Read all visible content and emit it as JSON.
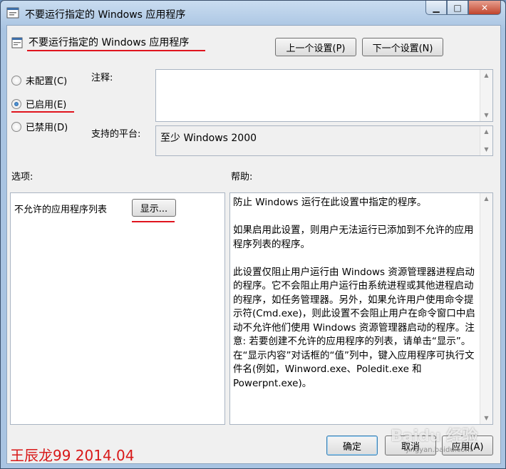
{
  "window": {
    "title": "不要运行指定的 Windows 应用程序",
    "caption_min": "▁",
    "caption_max": "□",
    "caption_close": "✕"
  },
  "header": {
    "setting_name": "不要运行指定的 Windows 应用程序",
    "prev_button": "上一个设置(P)",
    "next_button": "下一个设置(N)"
  },
  "state": {
    "options": [
      {
        "label": "未配置(C)",
        "checked": false
      },
      {
        "label": "已启用(E)",
        "checked": true
      },
      {
        "label": "已禁用(D)",
        "checked": false
      }
    ]
  },
  "comment": {
    "label": "注释:",
    "value": ""
  },
  "platform": {
    "label": "支持的平台:",
    "value": "至少 Windows 2000"
  },
  "options_section": {
    "label": "选项:",
    "item_label": "不允许的应用程序列表",
    "show_button": "显示..."
  },
  "help_section": {
    "label": "帮助:",
    "paragraphs": [
      "防止 Windows 运行在此设置中指定的程序。",
      "如果启用此设置，则用户无法运行已添加到不允许的应用程序列表的程序。",
      "此设置仅阻止用户运行由 Windows 资源管理器进程启动的程序。它不会阻止用户运行由系统进程或其他进程启动的程序，如任务管理器。另外，如果允许用户使用命令提示符(Cmd.exe)，则此设置不会阻止用户在命令窗口中启动不允许他们使用 Windows 资源管理器启动的程序。注意: 若要创建不允许的应用程序的列表，请单击“显示”。在“显示内容”对话框的“值”列中，键入应用程序可执行文件名(例如，Winword.exe、Poledit.exe 和 Powerpnt.exe)。"
    ]
  },
  "footer": {
    "ok_button": "确定",
    "cancel_button": "取消",
    "apply_button": "应用(A)"
  },
  "overlay": {
    "watermark_text": "王辰龙99 2014.04",
    "baidu_text": "Baidu 经验",
    "baidu_sub": "jingyan.baidu.com"
  },
  "colors": {
    "accent_red": "#e0141e",
    "window_frame": "#a9c4e2"
  }
}
